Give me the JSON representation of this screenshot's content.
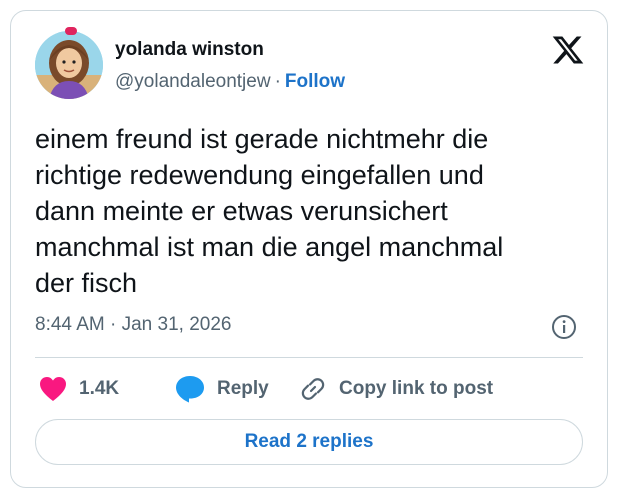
{
  "user": {
    "name": "yolanda winston",
    "handle": "@yolandaleontjew",
    "separator": "·",
    "follow_label": "Follow"
  },
  "tweet": {
    "text": "einem freund ist gerade nichtmehr die\nrichtige redewendung eingefallen und\ndann meinte er etwas verunsichert\nmanchmal ist man die angel manchmal\nder fisch",
    "time": "8:44 AM",
    "separator": "·",
    "date": "Jan 31, 2026"
  },
  "actions": {
    "likes": "1.4K",
    "reply_label": "Reply",
    "copy_label": "Copy link to post"
  },
  "read_replies_label": "Read 2 replies",
  "icons": {
    "brand": "x-logo-icon",
    "info": "info-icon",
    "like": "heart-icon",
    "reply": "speech-bubble-icon",
    "copy": "link-icon"
  },
  "colors": {
    "like": "#f91880",
    "reply": "#1d9bf0",
    "link": "#1d73c9",
    "muted": "#536471",
    "text": "#0f1419"
  }
}
